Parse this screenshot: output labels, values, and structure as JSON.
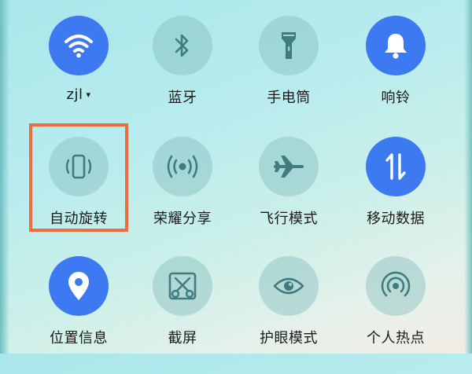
{
  "tiles": [
    {
      "label": "zjl",
      "state": "on",
      "icon": "wifi-icon",
      "has_dropdown": true
    },
    {
      "label": "蓝牙",
      "state": "off",
      "icon": "bluetooth-icon"
    },
    {
      "label": "手电筒",
      "state": "off",
      "icon": "flashlight-icon"
    },
    {
      "label": "响铃",
      "state": "on",
      "icon": "bell-icon"
    },
    {
      "label": "自动旋转",
      "state": "off",
      "icon": "auto-rotate-icon",
      "highlighted": true
    },
    {
      "label": "荣耀分享",
      "state": "off",
      "icon": "share-signal-icon"
    },
    {
      "label": "飞行模式",
      "state": "off",
      "icon": "airplane-icon"
    },
    {
      "label": "移动数据",
      "state": "on",
      "icon": "mobile-data-icon"
    },
    {
      "label": "位置信息",
      "state": "on",
      "icon": "location-pin-icon"
    },
    {
      "label": "截屏",
      "state": "off",
      "icon": "screenshot-icon"
    },
    {
      "label": "护眼模式",
      "state": "off",
      "icon": "eye-icon"
    },
    {
      "label": "个人热点",
      "state": "off",
      "icon": "hotspot-icon"
    }
  ],
  "dropdown_caret": "▾",
  "colors": {
    "active": "#3d79f0",
    "inactive": "#80baba",
    "highlight_border": "#f06b3e"
  }
}
